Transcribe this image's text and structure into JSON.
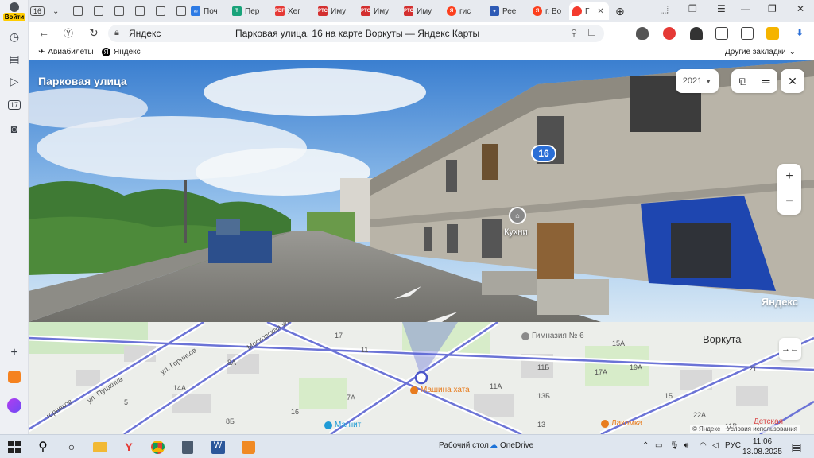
{
  "sidebar": {
    "login_label": "Войти",
    "calendar_day": "17"
  },
  "tabs": [
    {
      "label": "16",
      "icon": "tab-count",
      "color": "#4a4f57"
    },
    {
      "label": "",
      "icon": "doc-icon",
      "color": "#555"
    },
    {
      "label": "",
      "icon": "doc-icon",
      "color": "#555"
    },
    {
      "label": "",
      "icon": "doc-icon",
      "color": "#555"
    },
    {
      "label": "",
      "icon": "doc-icon",
      "color": "#555"
    },
    {
      "label": "",
      "icon": "doc-icon",
      "color": "#555"
    },
    {
      "label": "Поч",
      "icon": "mail-icon",
      "color": "#2d7be5"
    },
    {
      "label": "Пер",
      "icon": "translate-icon",
      "color": "#19a37a"
    },
    {
      "label": "Хег",
      "icon": "pdf-icon",
      "color": "#e53935"
    },
    {
      "label": "Иму",
      "icon": "rts-icon",
      "color": "#d32f2f"
    },
    {
      "label": "Иму",
      "icon": "rts-icon",
      "color": "#d32f2f"
    },
    {
      "label": "Иму",
      "icon": "rts-icon",
      "color": "#d32f2f"
    },
    {
      "label": "гис",
      "icon": "yandex-icon",
      "color": "#fc3f1d"
    },
    {
      "label": "Рее",
      "icon": "emblem-icon",
      "color": "#2d5ab5"
    },
    {
      "label": "г. Во",
      "icon": "yandex-icon",
      "color": "#fc3f1d"
    },
    {
      "label": "Г",
      "icon": "maps-pin-icon",
      "color": "#f43b2e"
    }
  ],
  "addressbar": {
    "host": "Яндекс",
    "title": "Парковая улица, 16 на карте Воркуты — Яндекс Карты"
  },
  "bookmarks": {
    "item1": "Авиабилеты",
    "item2": "Яндекс",
    "other": "Другие закладки"
  },
  "panorama": {
    "street_title": "Парковая улица",
    "year": "2021",
    "house_number": "16",
    "poi_label": "Кухни",
    "brand": "Яндекс"
  },
  "map": {
    "city": "Воркута",
    "streets": [
      "ул. Горняков",
      "ул. Пушкина",
      "горняков",
      "Московская ул."
    ],
    "numbers": [
      "17",
      "11",
      "8А",
      "14А",
      "5",
      "8Б",
      "16",
      "11Б",
      "13Б",
      "15А",
      "17А",
      "19А",
      "11А",
      "7А",
      "13",
      "15",
      "21",
      "22А",
      "11В"
    ],
    "poi": [
      {
        "name": "Гимназия № 6",
        "color": "#777"
      },
      {
        "name": "Машина хата",
        "color": "#e87c1e"
      },
      {
        "name": "Магнит",
        "color": "#1f9bd6"
      },
      {
        "name": "Лакомка",
        "color": "#e87c1e"
      },
      {
        "name": "Детская",
        "color": "#d94a4a"
      }
    ],
    "copyright": "© Яндекс",
    "terms": "Условия использования"
  },
  "taskbar": {
    "desktop": "Рабочий стол",
    "onedrive": "OneDrive",
    "lang": "РУС",
    "time": "11:06",
    "date": "13.08.2025"
  }
}
